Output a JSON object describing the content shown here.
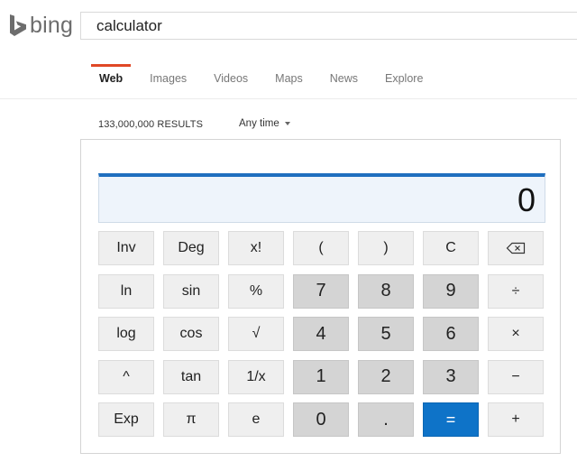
{
  "brand": {
    "name": "bing",
    "logo_icon": "bing-b-logo-icon",
    "logo_color": "#6d6d6d"
  },
  "search": {
    "value": "calculator",
    "placeholder": ""
  },
  "nav": {
    "accent": "#e04826",
    "items": [
      {
        "label": "Web",
        "active": true
      },
      {
        "label": "Images",
        "active": false
      },
      {
        "label": "Videos",
        "active": false
      },
      {
        "label": "Maps",
        "active": false
      },
      {
        "label": "News",
        "active": false
      },
      {
        "label": "Explore",
        "active": false
      }
    ]
  },
  "results": {
    "count": "133,000,000 RESULTS",
    "time_filter": "Any time"
  },
  "calculator": {
    "display": "0",
    "accent": "#1f6fbf",
    "equals_color": "#0e73c8",
    "keys": [
      [
        {
          "label": "Inv",
          "name": "key-inv",
          "type": "fn"
        },
        {
          "label": "Deg",
          "name": "key-deg",
          "type": "fn"
        },
        {
          "label": "x!",
          "name": "key-factorial",
          "type": "fn"
        },
        {
          "label": "(",
          "name": "key-open-paren",
          "type": "fn"
        },
        {
          "label": ")",
          "name": "key-close-paren",
          "type": "fn"
        },
        {
          "label": "C",
          "name": "key-clear",
          "type": "fn"
        },
        {
          "label": "",
          "name": "backspace-key",
          "type": "fn",
          "icon": "backspace-icon"
        }
      ],
      [
        {
          "label": "ln",
          "name": "key-ln",
          "type": "fn"
        },
        {
          "label": "sin",
          "name": "key-sin",
          "type": "fn"
        },
        {
          "label": "%",
          "name": "key-percent",
          "type": "fn"
        },
        {
          "label": "7",
          "name": "key-7",
          "type": "num"
        },
        {
          "label": "8",
          "name": "key-8",
          "type": "num"
        },
        {
          "label": "9",
          "name": "key-9",
          "type": "num"
        },
        {
          "label": "÷",
          "name": "key-divide",
          "type": "fn"
        }
      ],
      [
        {
          "label": "log",
          "name": "key-log",
          "type": "fn"
        },
        {
          "label": "cos",
          "name": "key-cos",
          "type": "fn"
        },
        {
          "label": "√",
          "name": "key-sqrt",
          "type": "fn"
        },
        {
          "label": "4",
          "name": "key-4",
          "type": "num"
        },
        {
          "label": "5",
          "name": "key-5",
          "type": "num"
        },
        {
          "label": "6",
          "name": "key-6",
          "type": "num"
        },
        {
          "label": "×",
          "name": "key-multiply",
          "type": "fn"
        }
      ],
      [
        {
          "label": "^",
          "name": "key-power",
          "type": "fn"
        },
        {
          "label": "tan",
          "name": "key-tan",
          "type": "fn"
        },
        {
          "label": "1/x",
          "name": "key-reciprocal",
          "type": "fn"
        },
        {
          "label": "1",
          "name": "key-1",
          "type": "num"
        },
        {
          "label": "2",
          "name": "key-2",
          "type": "num"
        },
        {
          "label": "3",
          "name": "key-3",
          "type": "num"
        },
        {
          "label": "−",
          "name": "key-subtract",
          "type": "fn"
        }
      ],
      [
        {
          "label": "Exp",
          "name": "key-exp",
          "type": "fn"
        },
        {
          "label": "π",
          "name": "key-pi",
          "type": "fn"
        },
        {
          "label": "e",
          "name": "key-e",
          "type": "fn"
        },
        {
          "label": "0",
          "name": "key-0",
          "type": "num"
        },
        {
          "label": ".",
          "name": "key-decimal",
          "type": "num"
        },
        {
          "label": "=",
          "name": "key-equals",
          "type": "eq"
        },
        {
          "label": "+",
          "name": "key-add",
          "type": "fn"
        }
      ]
    ]
  }
}
